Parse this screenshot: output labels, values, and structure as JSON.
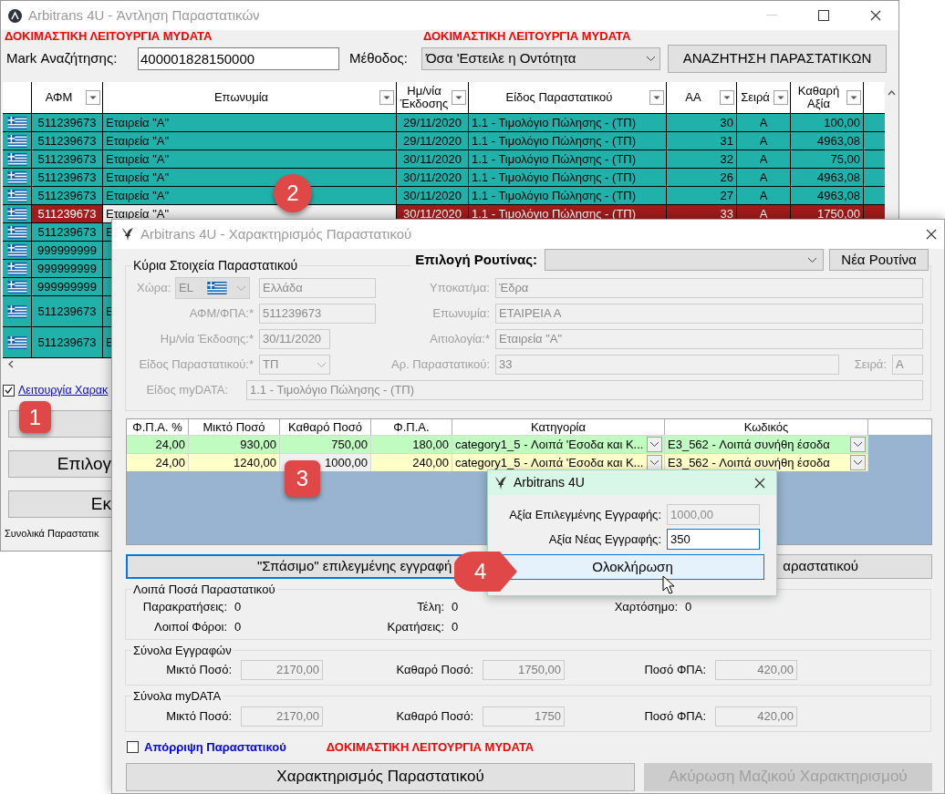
{
  "main_window": {
    "title": "Arbitrans 4U - Άντληση Παραστατικών",
    "test_mode_labels": [
      "ΔΟΚΙΜΑΣΤΙΚΗ ΛΕΙΤΟΥΡΓΙΑ MYDATA",
      "ΔΟΚΙΜΑΣΤΙΚΗ ΛΕΙΤΟΥΡΓΙΑ MYDATA"
    ],
    "mark_search": {
      "label": "Mark Αναζήτησης:",
      "value": "400001828150000"
    },
    "method": {
      "label": "Μέθοδος:",
      "value": "Όσα 'Εστειλε η Οντότητα"
    },
    "search_button": "ΑΝΑΖΗΤΗΣΗ ΠΑΡΑΣΤΑΤΙΚΩΝ",
    "columns": [
      "ΑΦΜ",
      "Επωνυμία",
      "Ημ/νία Έκδοσης",
      "Είδος Παραστατικού",
      "ΑΑ",
      "Σειρά",
      "Καθαρή Αξία"
    ],
    "rows": [
      {
        "afm": "511239673",
        "name": "Εταιρεία \"Α\"",
        "date": "29/11/2020",
        "type": "1.1 - Τιμολόγιο Πώλησης - (ΤΠ)",
        "aa": "30",
        "series": "Α",
        "net": "100,00",
        "selected": false
      },
      {
        "afm": "511239673",
        "name": "Εταιρεία \"Α\"",
        "date": "29/11/2020",
        "type": "1.1 - Τιμολόγιο Πώλησης - (ΤΠ)",
        "aa": "31",
        "series": "Α",
        "net": "4963,08",
        "selected": false
      },
      {
        "afm": "511239673",
        "name": "Εταιρεία \"Α\"",
        "date": "30/11/2020",
        "type": "1.1 - Τιμολόγιο Πώλησης - (ΤΠ)",
        "aa": "32",
        "series": "Α",
        "net": "75,00",
        "selected": false
      },
      {
        "afm": "511239673",
        "name": "Εταιρεία \"Α\"",
        "date": "30/11/2020",
        "type": "1.1 - Τιμολόγιο Πώλησης - (ΤΠ)",
        "aa": "26",
        "series": "Α",
        "net": "4963,08",
        "selected": false
      },
      {
        "afm": "511239673",
        "name": "Εταιρεία \"Α\"",
        "date": "30/11/2020",
        "type": "1.1 - Τιμολόγιο Πώλησης - (ΤΠ)",
        "aa": "27",
        "series": "Α",
        "net": "4963,08",
        "selected": false
      },
      {
        "afm": "511239673",
        "name": "Εταιρεία \"Α\"",
        "date": "30/11/2020",
        "type": "1.1 - Τιμολόγιο Πώλησης - (ΤΠ)",
        "aa": "33",
        "series": "Α",
        "net": "1750,00",
        "selected": true
      },
      {
        "afm": "511239673",
        "name": "Ε",
        "selected": false
      },
      {
        "afm": "999999999",
        "selected": false
      },
      {
        "afm": "999999999",
        "selected": false
      },
      {
        "afm": "999999999",
        "selected": false
      },
      {
        "afm": "511239673",
        "name": "Ε",
        "selected": false
      },
      {
        "afm": "511239673",
        "name": "Ε",
        "selected": false
      }
    ],
    "characterization_mode": {
      "label": "Λειτουργία Χαρακ",
      "checked": true
    },
    "buttons": [
      "Επιλογ",
      "Εκ"
    ],
    "totals_label": "Συνολικά Παραστατικ"
  },
  "characterization_window": {
    "title": "Arbitrans 4U - Χαρακτηρισμός Παραστατικού",
    "routine": {
      "label": "Επιλογή Ρουτίνας:",
      "button": "Νέα Ρουτίνα"
    },
    "main_group": {
      "title": "Κύρια Στοιχεία Παραστατικού",
      "disabled": true,
      "country": {
        "label": "Χώρα:",
        "code": "EL",
        "name": "Ελλάδα"
      },
      "vat": {
        "label": "ΑΦΜ/ΦΠΑ:*",
        "value": "511239673"
      },
      "issue_date": {
        "label": "Ημ/νία Έκδοσης:*",
        "value": "30/11/2020"
      },
      "doc_type": {
        "label": "Είδος Παραστατικού:*",
        "value": "ΤΠ"
      },
      "mydata_type": {
        "label": "Είδος myDATA:",
        "value": "1.1 - Τιμολόγιο Πώλησης - (ΤΠ)"
      },
      "branch": {
        "label": "Υποκατ/μα:",
        "value": "Έδρα"
      },
      "company": {
        "label": "Επωνυμία:",
        "value": "ΕΤΑΙΡΕΙΑ Α"
      },
      "reason": {
        "label": "Αιτιολογία:*",
        "value": "Εταιρεία \"Α\""
      },
      "doc_number": {
        "label": "Αρ. Παραστατικού:",
        "value": "33"
      },
      "series": {
        "label": "Σειρά:",
        "value": "Α"
      }
    },
    "lines": {
      "columns": [
        "Φ.Π.Α. %",
        "Μικτό Ποσό",
        "Καθαρό Ποσό",
        "Φ.Π.Α.",
        "Κατηγορία",
        "Κωδικός"
      ],
      "rows": [
        {
          "color": "#c0fcc0",
          "selected": false,
          "cells": [
            "24,00",
            "930,00",
            "750,00",
            "180,00",
            "category1_5  - Λοιπά 'Εσοδα και Κ...",
            "E3_562 - Λοιπά συνήθη έσοδα"
          ]
        },
        {
          "color": "#ffffc8",
          "selected": true,
          "cells": [
            "24,00",
            "1240,00",
            "1000,00",
            "240,00",
            "category1_5  - Λοιπά 'Εσοδα και Κ...",
            "E3_562 - Λοιπά συνήθη έσοδα"
          ]
        }
      ]
    },
    "split_button": "\"Σπάσιμο\" επιλεγμένης εγγραφή",
    "update_button": "αραστατικού",
    "other_amounts": {
      "title": "Λοιπά Ποσά Παραστατικού",
      "items": [
        {
          "label": "Παρακρατήσεις:",
          "value": "0"
        },
        {
          "label": "Τέλη:",
          "value": "0"
        },
        {
          "label": "Χαρτόσημο:",
          "value": "0"
        },
        {
          "label": "Λοιποί Φόροι:",
          "value": "0"
        },
        {
          "label": "Κρατήσεις:",
          "value": "0"
        }
      ]
    },
    "totals": [
      {
        "title": "Σύνολα Εγγραφών",
        "items": [
          {
            "label": "Μικτό Ποσό:",
            "value": "2170,00"
          },
          {
            "label": "Καθαρό Ποσό:",
            "value": "1750,00"
          },
          {
            "label": "Ποσό ΦΠΑ:",
            "value": "420,00"
          }
        ]
      },
      {
        "title": "Σύνολα myDATA",
        "items": [
          {
            "label": "Μικτό Ποσό:",
            "value": "2170,00"
          },
          {
            "label": "Καθαρό Ποσό:",
            "value": "1750"
          },
          {
            "label": "Ποσό ΦΠΑ:",
            "value": "420,00"
          }
        ]
      }
    ],
    "reject": {
      "label": "Απόρριψη Παραστατικού",
      "checked": false
    },
    "test_mode_label": "ΔΟΚΙΜΑΣΤΙΚΗ ΛΕΙΤΟΥΡΓΙΑ MYDATA",
    "characterize_button": "Χαρακτηρισμός Παραστατικού",
    "cancel_button": {
      "label": "Ακύρωση Μαζικού Χαρακτηρισμού",
      "disabled": true
    }
  },
  "split_dialog": {
    "title": "Arbitrans 4U",
    "selected_value": {
      "label": "Αξία Επιλεγμένης Εγγραφής:",
      "value": "1000,00"
    },
    "new_value": {
      "label": "Αξία Νέας Εγγραφής:",
      "value": "350"
    },
    "button": "Ολοκλήρωση"
  },
  "callouts": [
    {
      "label": "1",
      "kind": "square"
    },
    {
      "label": "2",
      "kind": "circle"
    },
    {
      "label": "3",
      "kind": "square"
    },
    {
      "label": "4",
      "kind": "arrow"
    }
  ]
}
